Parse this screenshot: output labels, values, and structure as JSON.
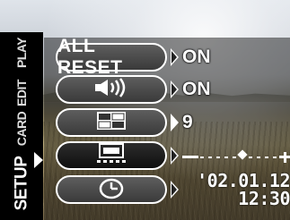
{
  "tabs": [
    {
      "label": "PLAY",
      "active": false
    },
    {
      "label": "EDIT",
      "active": false
    },
    {
      "label": "CARD",
      "active": false
    },
    {
      "label": "SETUP",
      "active": true
    }
  ],
  "menu": {
    "all_reset": {
      "label": "ALL RESET",
      "value": "ON"
    },
    "beep": {
      "icon": "speaker-beep-icon",
      "value": "ON"
    },
    "rec_view": {
      "icon": "rec-view-icon",
      "value": "9"
    },
    "monitor_brightness": {
      "icon": "monitor-brightness-icon",
      "level": 0.55
    },
    "date_time": {
      "icon": "clock-icon",
      "date": "'02.01.12",
      "time": "12:30"
    }
  },
  "colors": {
    "panel": "#000000",
    "text": "#ffffff",
    "pill": "#4a4a4a"
  }
}
